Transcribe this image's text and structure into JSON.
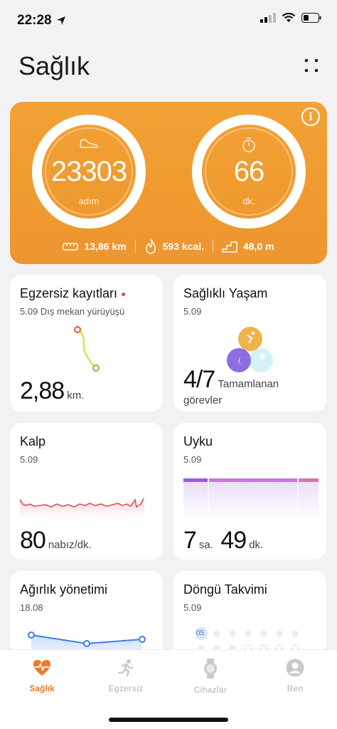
{
  "status": {
    "time": "22:28"
  },
  "header": {
    "title": "Sağlık"
  },
  "hero": {
    "steps": {
      "value": "23303",
      "unit": "adım"
    },
    "minutes": {
      "value": "66",
      "unit": "dk."
    },
    "stats": {
      "distance": "13,86 km",
      "calories": "593 kcal.",
      "floors": "48,0 m"
    },
    "accent": "#ef9a2f"
  },
  "cards": {
    "exercise": {
      "title": "Egzersiz kayıtları",
      "subtitle": "5.09 Dış mekan yürüyüşü",
      "value": "2,88",
      "unit": "km."
    },
    "healthy": {
      "title": "Sağlıklı Yaşam",
      "date": "5.09",
      "value": "4/7",
      "label_line1": "Tamamlanan",
      "label_line2": "görevler"
    },
    "heart": {
      "title": "Kalp",
      "date": "5.09",
      "value": "80",
      "unit": "nabız/dk."
    },
    "sleep": {
      "title": "Uyku",
      "date": "5.09",
      "hours": "7",
      "hours_unit": "sa.",
      "minutes": "49",
      "minutes_unit": "dk."
    },
    "weight": {
      "title": "Ağırlık yönetimi",
      "date": "18.08"
    },
    "cycle": {
      "title": "Döngü Takvimi",
      "date": "5.09",
      "day": "05"
    }
  },
  "tabs": [
    {
      "label": "Sağlık",
      "icon": "heart-icon",
      "active": true
    },
    {
      "label": "Egzersiz",
      "icon": "runner-icon",
      "active": false
    },
    {
      "label": "Cihazlar",
      "icon": "watch-icon",
      "active": false
    },
    {
      "label": "Ben",
      "icon": "person-icon",
      "active": false
    }
  ]
}
